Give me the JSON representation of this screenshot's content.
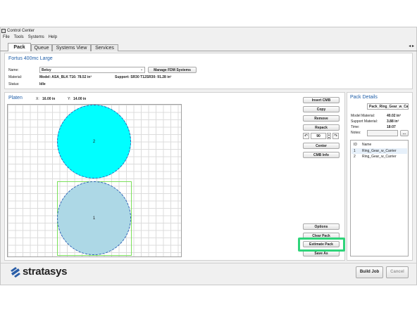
{
  "window": {
    "title": "Control Center"
  },
  "menu": [
    "File",
    "Tools",
    "Systems",
    "Help"
  ],
  "tabs": [
    "Pack",
    "Queue",
    "Systems View",
    "Services"
  ],
  "printer": {
    "title": "Fortus 400mc Large",
    "name_label": "Name:",
    "name_value": "Betsy",
    "manage_button": "Manage FDM Systems",
    "material_label": "Material:",
    "model_material": "Model: ASA_BLK T16: 78.52 in³",
    "support_material": "Support: SR30  T12SR30: 91.28 in³",
    "status_label": "Status:",
    "status_value": "Idle"
  },
  "platen": {
    "title": "Platen",
    "x_label": "X:",
    "x_value": "16.00 in",
    "y_label": "Y:",
    "y_value": "14.00 in",
    "parts": [
      {
        "label": "2",
        "color": "#00ffff",
        "selected": false
      },
      {
        "label": "1",
        "color": "#add8e6",
        "selected": true
      }
    ]
  },
  "tools": {
    "insert": "Insert CMB",
    "copy": "Copy",
    "remove": "Remove",
    "repack": "Repack",
    "rotate_value": "90",
    "center": "Center",
    "cmb_info": "CMB Info",
    "options": "Options",
    "clear_pack": "Clear Pack",
    "estimate_pack": "Estimate Pack",
    "save_as": "Save As"
  },
  "pack_details": {
    "title": "Pack Details",
    "name": "Pack_Ring_Gear_w_Carrier",
    "model_material_label": "Model Material:",
    "model_material_value": "40.02 in³",
    "support_material_label": "Support Material:",
    "support_material_value": "3.88 in³",
    "time_label": "Time:",
    "time_value": "18:07",
    "notes_label": "Notes:",
    "notes_button": "...",
    "columns": [
      "ID",
      "Name"
    ],
    "rows": [
      {
        "id": "1",
        "name": "Ring_Gear_w_Carrier"
      },
      {
        "id": "2",
        "name": "Ring_Gear_w_Carrier"
      }
    ]
  },
  "footer": {
    "logo": "stratasys",
    "build_job": "Build Job",
    "cancel": "Cancel"
  },
  "colors": {
    "accent": "#1f5ea8",
    "highlight": "#2fd47a",
    "selection": "#7be05a"
  }
}
